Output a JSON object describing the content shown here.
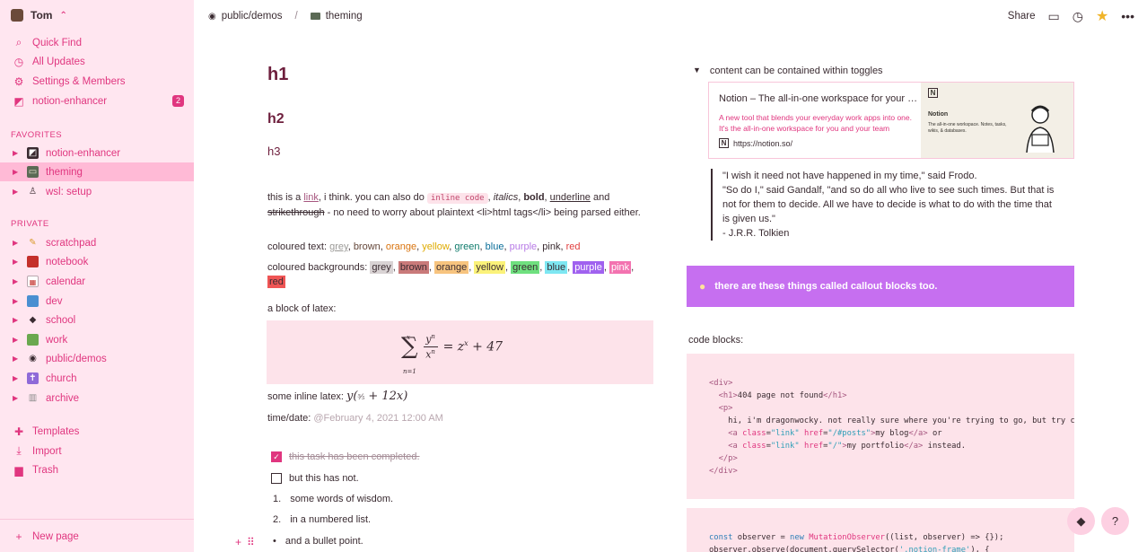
{
  "sidebar": {
    "workspace": "Tom",
    "top_items": [
      {
        "icon": "search-icon",
        "label": "Quick Find"
      },
      {
        "icon": "clock-icon",
        "label": "All Updates"
      },
      {
        "icon": "gear-icon",
        "label": "Settings & Members"
      },
      {
        "icon": "enhancer-icon",
        "label": "notion-enhancer",
        "badge": "2"
      }
    ],
    "favorites_label": "FAVORITES",
    "favorites": [
      {
        "label": "notion-enhancer"
      },
      {
        "label": "theming"
      },
      {
        "label": "wsl: setup"
      }
    ],
    "private_label": "PRIVATE",
    "private": [
      {
        "label": "scratchpad"
      },
      {
        "label": "notebook"
      },
      {
        "label": "calendar"
      },
      {
        "label": "dev"
      },
      {
        "label": "school"
      },
      {
        "label": "work"
      },
      {
        "label": "public/demos"
      },
      {
        "label": "church"
      },
      {
        "label": "archive"
      }
    ],
    "bottom_items": [
      {
        "label": "Templates"
      },
      {
        "label": "Import"
      },
      {
        "label": "Trash"
      }
    ],
    "new_page": "New page"
  },
  "topbar": {
    "crumbs": [
      "public/demos",
      "theming"
    ],
    "share": "Share"
  },
  "content": {
    "h1": "h1",
    "h2": "h2",
    "h3": "h3",
    "para1": {
      "t1": "this is a ",
      "link": "link",
      "t2": ", i think. you can also do ",
      "code": "inline code",
      "t3": ", ",
      "italics": "italics",
      "t4": ", ",
      "bold": "bold",
      "t5": ", ",
      "underline": "underline",
      "t6": " and ",
      "strike": "strikethrough",
      "t7": " - no need to worry about plaintext <li>html tags</li> being parsed either."
    },
    "coloured_text": {
      "label": "coloured text: ",
      "items": [
        "grey",
        "brown",
        "orange",
        "yellow",
        "green",
        "blue",
        "purple",
        "pink",
        "red"
      ]
    },
    "coloured_bg": {
      "label": "coloured backgrounds: ",
      "items": [
        "grey",
        "brown",
        "orange",
        "yellow",
        "green",
        "blue",
        "purple",
        "pink",
        "red"
      ]
    },
    "latex_label": "a block of latex:",
    "inline_latex_label": "some inline latex: ",
    "time_label": "time/date: ",
    "time_value": "@February 4, 2021 12:00 AM",
    "todo_done": "this task has been completed.",
    "todo_open": "but this has not.",
    "numbered": [
      "some words of wisdom.",
      "in a numbered list."
    ],
    "numbered_markers": [
      "1.",
      "2."
    ],
    "bullet": "and a bullet point."
  },
  "right": {
    "toggle": "content can be contained within toggles",
    "bookmark": {
      "title": "Notion – The all-in-one workspace for your notes, tasks, wikis, and databases.",
      "desc": "A new tool that blends your everyday work apps into one. It's the all-in-one workspace for you and your team",
      "url": "https://notion.so/",
      "img_title": "Notion",
      "img_sub": "The all-in-one workspace. Notes, tasks, wikis, & databases."
    },
    "quote": [
      "\"I wish it need not have happened in my time,\" said Frodo.",
      "\"So do I,\" said Gandalf, \"and so do all who live to see such times. But that is not for them to decide. All we have to decide is what to do with the time that is given us.\"",
      "- J.R.R. Tolkien"
    ],
    "callout": "there are these things called callout blocks too.",
    "code_label": "code blocks:"
  },
  "colors": {
    "accent": "#e0367f",
    "sidebar_bg": "#ffe6f0",
    "callout_bg": "#c66ff0"
  }
}
